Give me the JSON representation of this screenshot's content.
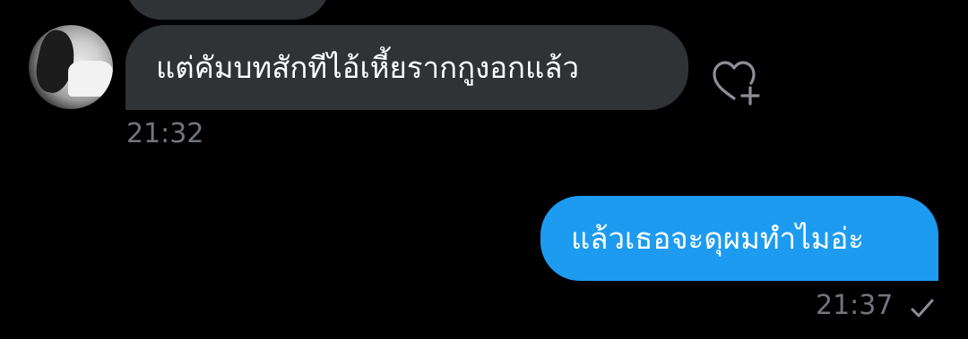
{
  "colors": {
    "background": "#000000",
    "incoming_bubble": "#2f3336",
    "outgoing_bubble": "#1d9bf0",
    "timestamp": "#71767b",
    "text": "#ffffff"
  },
  "messages": [
    {
      "direction": "incoming",
      "text": "แต่คัมบทสักทีไอ้เหี้ยรากกูงอกแล้ว",
      "time": "21:32",
      "icon": "heart-add-icon"
    },
    {
      "direction": "outgoing",
      "text": "แล้วเธอจะดุผมทำไมอ่ะ",
      "time": "21:37",
      "status_icon": "check-icon"
    }
  ]
}
